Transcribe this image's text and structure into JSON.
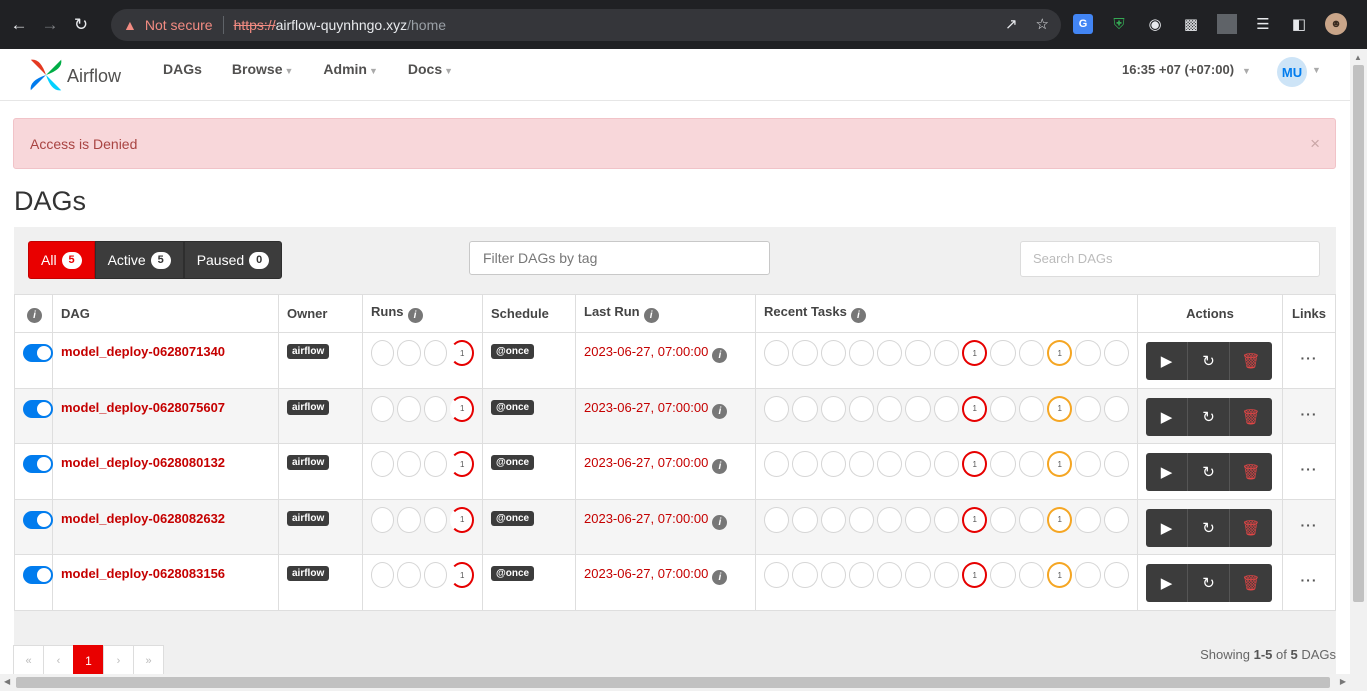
{
  "browser": {
    "security_label": "Not secure",
    "url_scheme": "https://",
    "url_host": "airflow-quynhngo.xyz",
    "url_path": "/home"
  },
  "navbar": {
    "brand": "Airflow",
    "menu": [
      {
        "label": "DAGs"
      },
      {
        "label": "Browse"
      },
      {
        "label": "Admin"
      },
      {
        "label": "Docs"
      }
    ],
    "clock": "16:35 +07 (+07:00)",
    "user_initials": "MU"
  },
  "alert": {
    "message": "Access is Denied",
    "close": "×"
  },
  "page_title": "DAGs",
  "filters": {
    "status": [
      {
        "label": "All",
        "count": "5"
      },
      {
        "label": "Active",
        "count": "5"
      },
      {
        "label": "Paused",
        "count": "0"
      }
    ],
    "tag_placeholder": "Filter DAGs by tag",
    "search_placeholder": "Search DAGs"
  },
  "table": {
    "headers": {
      "dag": "DAG",
      "owner": "Owner",
      "runs": "Runs",
      "schedule": "Schedule",
      "last_run": "Last Run",
      "recent_tasks": "Recent Tasks",
      "actions": "Actions",
      "links": "Links"
    },
    "rows": [
      {
        "dag_id": "model_deploy-0628071340",
        "owner": "airflow",
        "schedule": "@once",
        "last_run": "2023-06-27, 07:00:00"
      },
      {
        "dag_id": "model_deploy-0628075607",
        "owner": "airflow",
        "schedule": "@once",
        "last_run": "2023-06-27, 07:00:00"
      },
      {
        "dag_id": "model_deploy-0628080132",
        "owner": "airflow",
        "schedule": "@once",
        "last_run": "2023-06-27, 07:00:00"
      },
      {
        "dag_id": "model_deploy-0628082632",
        "owner": "airflow",
        "schedule": "@once",
        "last_run": "2023-06-27, 07:00:00"
      },
      {
        "dag_id": "model_deploy-0628083156",
        "owner": "airflow",
        "schedule": "@once",
        "last_run": "2023-06-27, 07:00:00"
      }
    ],
    "run_circle_count": "1",
    "task_circle_count": "1"
  },
  "pagination": {
    "first": "«",
    "prev": "‹",
    "current": "1",
    "next": "›",
    "last": "»"
  },
  "footer": {
    "showing_prefix": "Showing ",
    "showing_range": "1-5",
    "showing_of": " of ",
    "showing_total": "5",
    "showing_suffix": " DAGs"
  },
  "colors": {
    "accent_red": "#e90000",
    "toggle_blue": "#017cee",
    "failed_red": "#e60000",
    "upstream_orange": "#f5a623"
  }
}
